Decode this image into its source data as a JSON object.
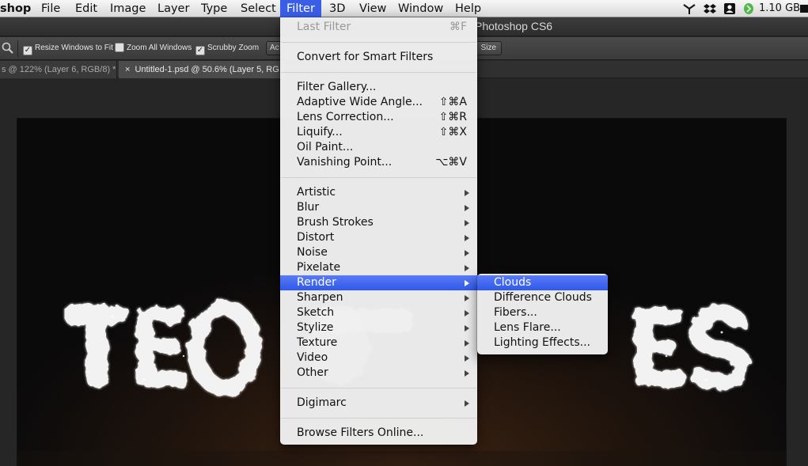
{
  "menubar": {
    "app": "shop",
    "items": [
      "File",
      "Edit",
      "Image",
      "Layer",
      "Type",
      "Select",
      "Filter",
      "3D",
      "View",
      "Window",
      "Help"
    ],
    "active": "Filter",
    "memory": "1.10 GB",
    "status_icons": [
      "network-icon",
      "dropbox-icon",
      "user-icon",
      "evernote-icon",
      "battery-icon"
    ]
  },
  "app_title": "Photoshop CS6",
  "options_bar": {
    "zoom_icon": "zoom-icon",
    "checks": [
      {
        "label": "Resize Windows to Fit",
        "checked": true
      },
      {
        "label": "Zoom All Windows",
        "checked": false
      },
      {
        "label": "Scrubby Zoom",
        "checked": true
      }
    ],
    "btn_partial": "Ac",
    "btn_size": "Size"
  },
  "tabs": [
    {
      "label": "s @ 122% (Layer 6, RGB/8) *",
      "active": false
    },
    {
      "close": "×",
      "label": "Untitled-1.psd @ 50.6% (Layer 5, RG",
      "active": true
    }
  ],
  "filter_menu": {
    "items": [
      {
        "label": "Last Filter",
        "shortcut": "⌘F",
        "disabled": true
      },
      {
        "label": "Convert for Smart Filters"
      },
      {
        "label": "Filter Gallery..."
      },
      {
        "label": "Adaptive Wide Angle...",
        "shortcut": "⇧⌘A"
      },
      {
        "label": "Lens Correction...",
        "shortcut": "⇧⌘R"
      },
      {
        "label": "Liquify...",
        "shortcut": "⇧⌘X"
      },
      {
        "label": "Oil Paint..."
      },
      {
        "label": "Vanishing Point...",
        "shortcut": "⌥⌘V"
      },
      {
        "label": "Artistic",
        "submenu": true
      },
      {
        "label": "Blur",
        "submenu": true
      },
      {
        "label": "Brush Strokes",
        "submenu": true
      },
      {
        "label": "Distort",
        "submenu": true
      },
      {
        "label": "Noise",
        "submenu": true
      },
      {
        "label": "Pixelate",
        "submenu": true
      },
      {
        "label": "Render",
        "submenu": true,
        "highlighted": true
      },
      {
        "label": "Sharpen",
        "submenu": true
      },
      {
        "label": "Sketch",
        "submenu": true
      },
      {
        "label": "Stylize",
        "submenu": true
      },
      {
        "label": "Texture",
        "submenu": true
      },
      {
        "label": "Video",
        "submenu": true
      },
      {
        "label": "Other",
        "submenu": true
      },
      {
        "label": "Digimarc",
        "submenu": true
      },
      {
        "label": "Browse Filters Online..."
      }
    ]
  },
  "render_submenu": {
    "items": [
      {
        "label": "Clouds",
        "highlighted": true
      },
      {
        "label": "Difference Clouds"
      },
      {
        "label": "Fibers..."
      },
      {
        "label": "Lens Flare..."
      },
      {
        "label": "Lighting Effects..."
      }
    ]
  },
  "colors": {
    "menu_highlight": "#3a5ee6",
    "workspace": "#262626",
    "smoke_text": "#f2f2f2"
  }
}
